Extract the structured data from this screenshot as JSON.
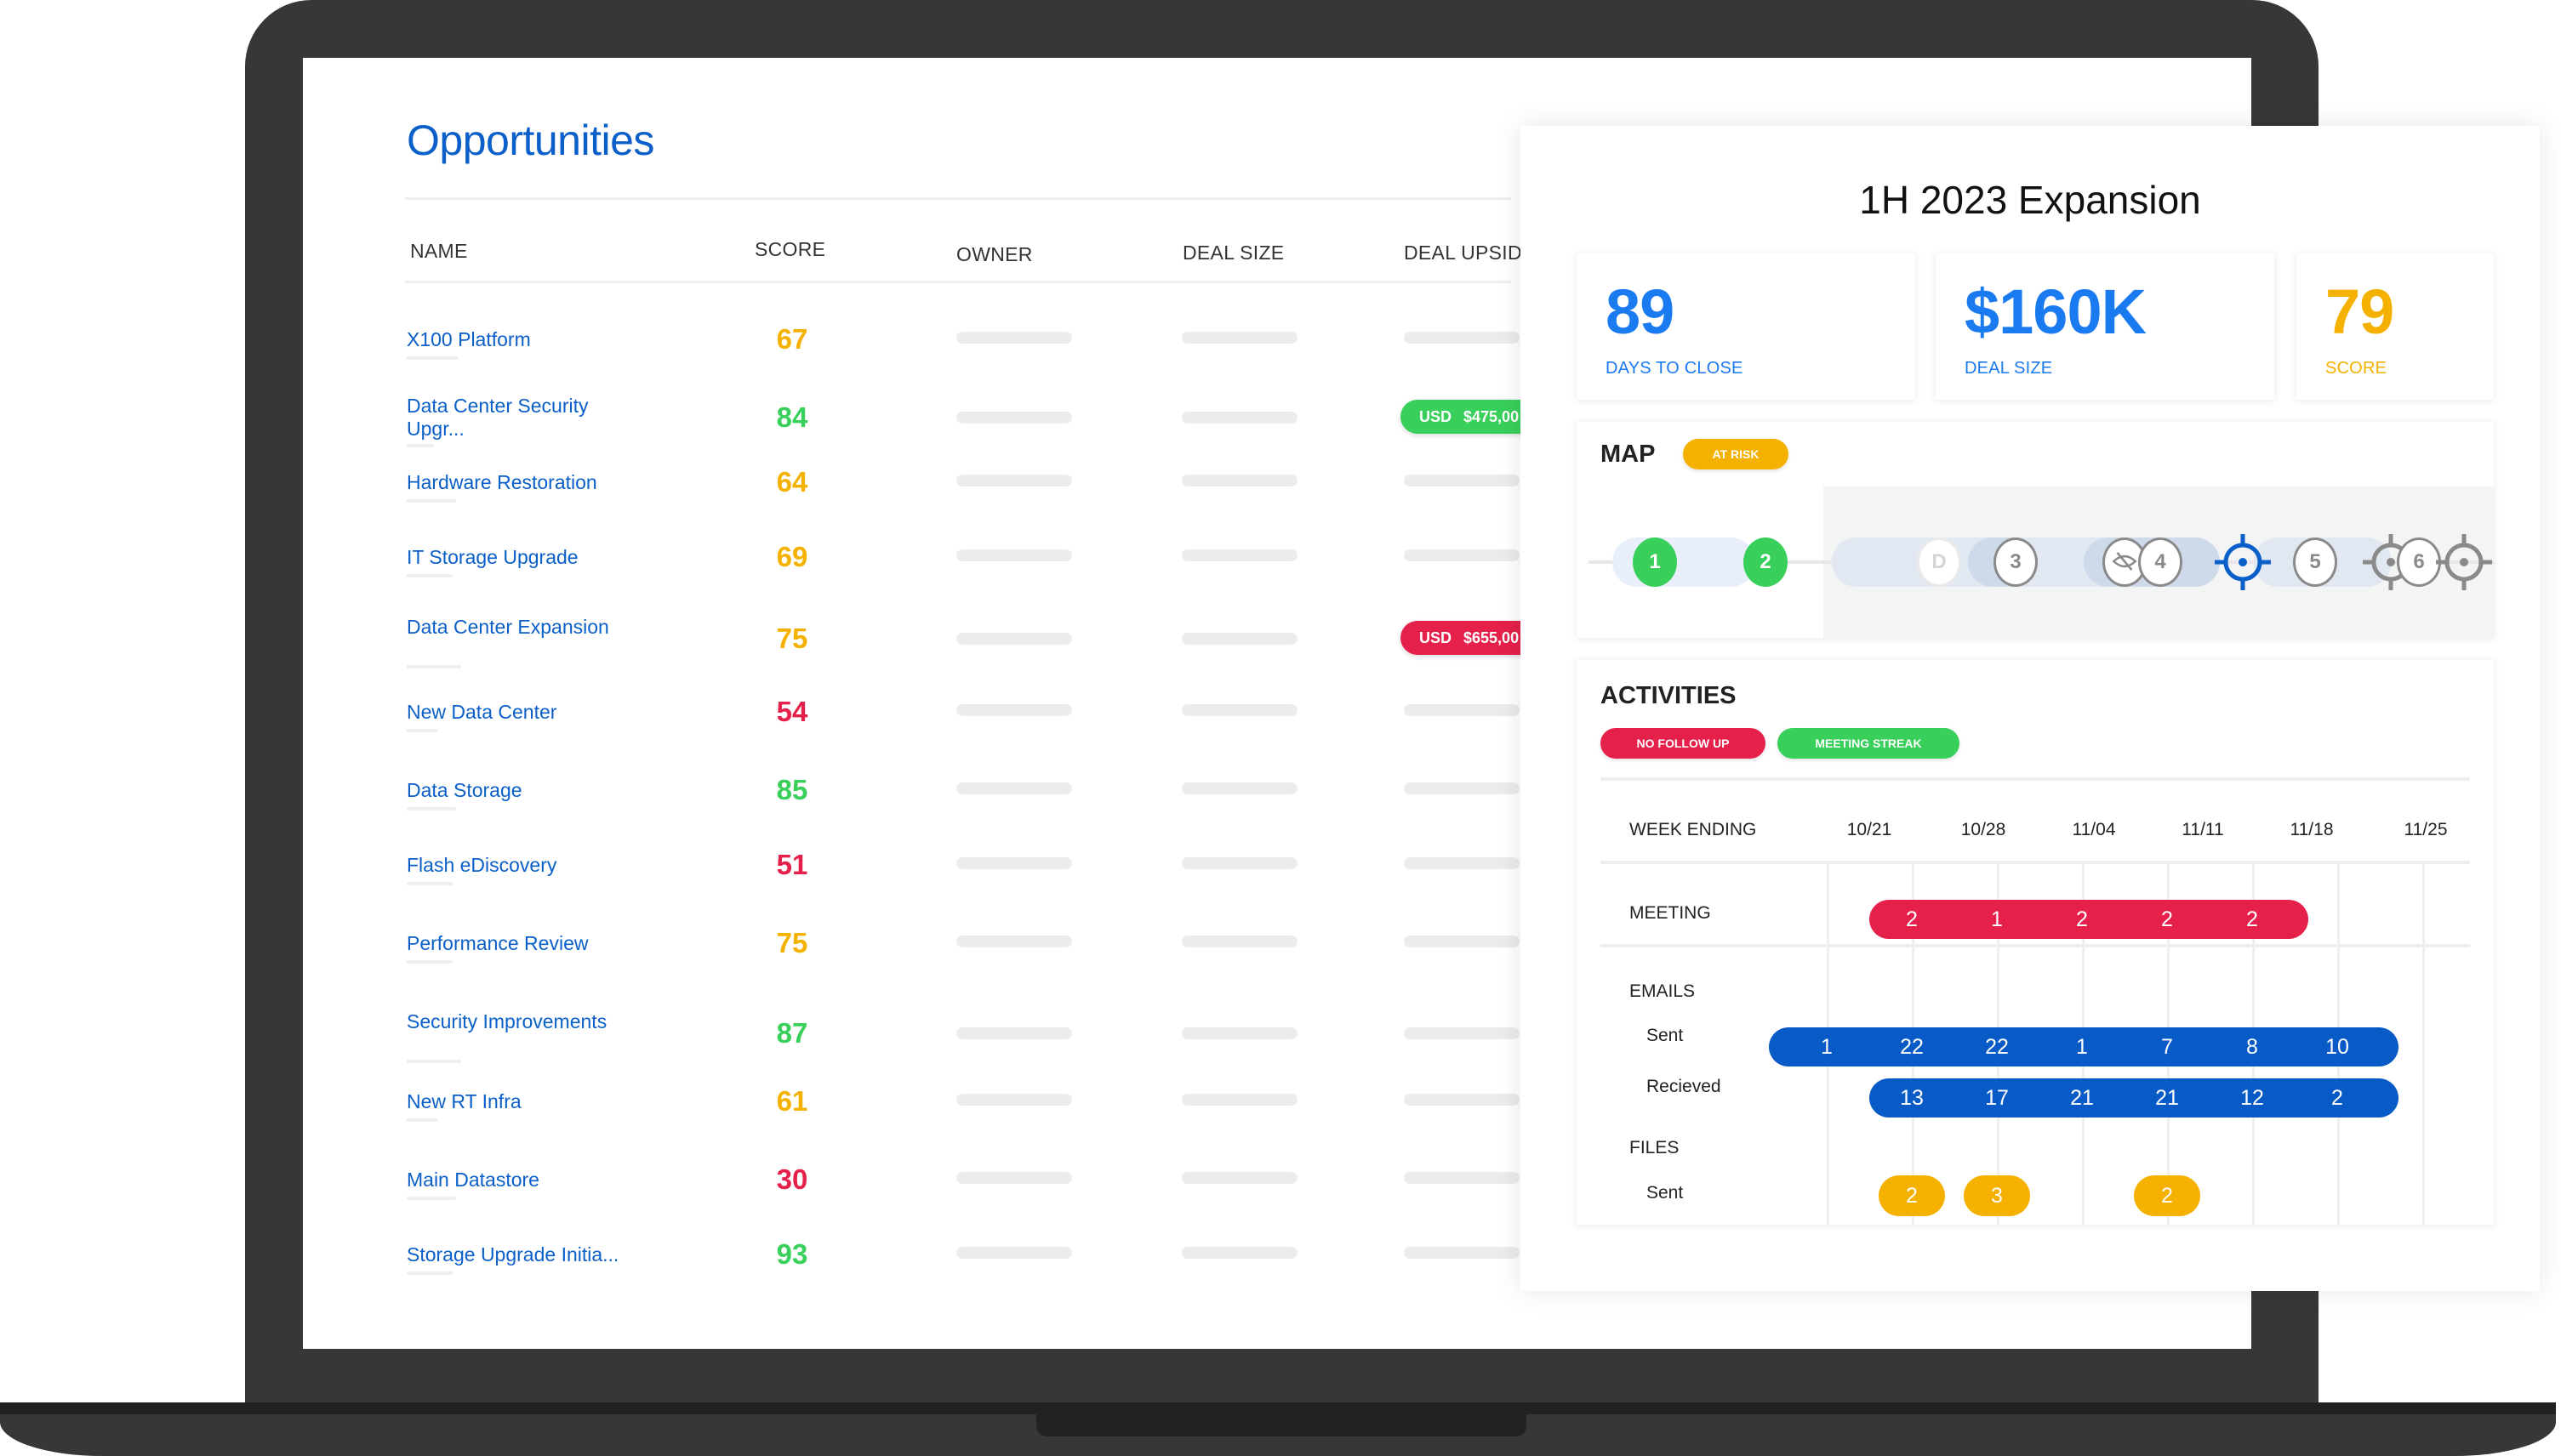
{
  "colors": {
    "brand_blue": "#0a5fc8",
    "kpi_blue": "#1a7bf0",
    "amber": "#f5b100",
    "green": "#38cf5a",
    "red": "#e5214b",
    "email_blue": "#085bc6"
  },
  "opportunities": {
    "title": "Opportunities",
    "columns": [
      "NAME",
      "SCORE",
      "OWNER",
      "DEAL SIZE",
      "DEAL UPSIDE"
    ],
    "rows": [
      {
        "name": "X100 Platform",
        "score": "67",
        "score_color": "amber",
        "upside": null
      },
      {
        "name": "Data Center Security Upgr...",
        "score": "84",
        "score_color": "green",
        "upside": {
          "currency": "USD",
          "amount": "$475,00",
          "color": "green"
        }
      },
      {
        "name": "Hardware Restoration",
        "score": "64",
        "score_color": "amber",
        "upside": null
      },
      {
        "name": "IT Storage Upgrade",
        "score": "69",
        "score_color": "amber",
        "upside": null
      },
      {
        "name": "Data Center Expansion",
        "score": "75",
        "score_color": "amber",
        "upside": {
          "currency": "USD",
          "amount": "$655,00",
          "color": "red"
        }
      },
      {
        "name": "New Data Center",
        "score": "54",
        "score_color": "red",
        "upside": null
      },
      {
        "name": "Data Storage",
        "score": "85",
        "score_color": "green",
        "upside": null
      },
      {
        "name": "Flash eDiscovery",
        "score": "51",
        "score_color": "red",
        "upside": null
      },
      {
        "name": "Performance Review",
        "score": "75",
        "score_color": "amber",
        "upside": null
      },
      {
        "name": "Security Improvements",
        "score": "87",
        "score_color": "green",
        "upside": null
      },
      {
        "name": "New RT Infra",
        "score": "61",
        "score_color": "amber",
        "upside": null
      },
      {
        "name": "Main Datastore",
        "score": "30",
        "score_color": "red",
        "upside": null
      },
      {
        "name": "Storage Upgrade Initia...",
        "score": "93",
        "score_color": "green",
        "upside": null
      }
    ]
  },
  "detail": {
    "title": "1H 2023 Expansion",
    "kpis": [
      {
        "value": "89",
        "label": "DAYS TO CLOSE",
        "color": "kpi_blue"
      },
      {
        "value": "$160K",
        "label": "DEAL SIZE",
        "color": "kpi_blue"
      },
      {
        "value": "79",
        "label": "SCORE",
        "color": "amber"
      }
    ],
    "map": {
      "title": "MAP",
      "status_badge": "AT RISK",
      "nodes": [
        {
          "label": "1",
          "state": "complete",
          "icon": "step-circle"
        },
        {
          "label": "2",
          "state": "complete",
          "icon": "step-circle"
        },
        {
          "label": "D",
          "state": "faded",
          "icon": "step-circle"
        },
        {
          "label": "3",
          "state": "pending",
          "icon": "step-circle"
        },
        {
          "label": "",
          "state": "hidden",
          "icon": "eye-slash-icon"
        },
        {
          "label": "4",
          "state": "pending",
          "icon": "step-circle"
        },
        {
          "label": "",
          "state": "current",
          "icon": "crosshair-icon"
        },
        {
          "label": "5",
          "state": "pending",
          "icon": "step-circle"
        },
        {
          "label": "",
          "state": "target",
          "icon": "crosshair-icon"
        },
        {
          "label": "6",
          "state": "pending",
          "icon": "step-circle"
        },
        {
          "label": "",
          "state": "target",
          "icon": "crosshair-icon"
        }
      ]
    },
    "activities": {
      "title": "ACTIVITIES",
      "badges": [
        "NO FOLLOW UP",
        "MEETING STREAK"
      ],
      "week_header": "WEEK ENDING",
      "weeks": [
        "10/21",
        "10/28",
        "11/04",
        "11/11",
        "11/18",
        "11/25"
      ],
      "meeting": {
        "label": "MEETING",
        "values": [
          "2",
          "1",
          "2",
          "2",
          "2"
        ]
      },
      "emails": {
        "label": "EMAILS",
        "sent": {
          "label": "Sent",
          "values": [
            "1",
            "22",
            "22",
            "1",
            "7",
            "8",
            "10"
          ]
        },
        "received": {
          "label": "Recieved",
          "values": [
            "13",
            "17",
            "21",
            "21",
            "12",
            "2"
          ]
        }
      },
      "files": {
        "label": "FILES",
        "sent": {
          "label": "Sent",
          "values": [
            "2",
            "3",
            "",
            "2"
          ]
        }
      }
    }
  }
}
